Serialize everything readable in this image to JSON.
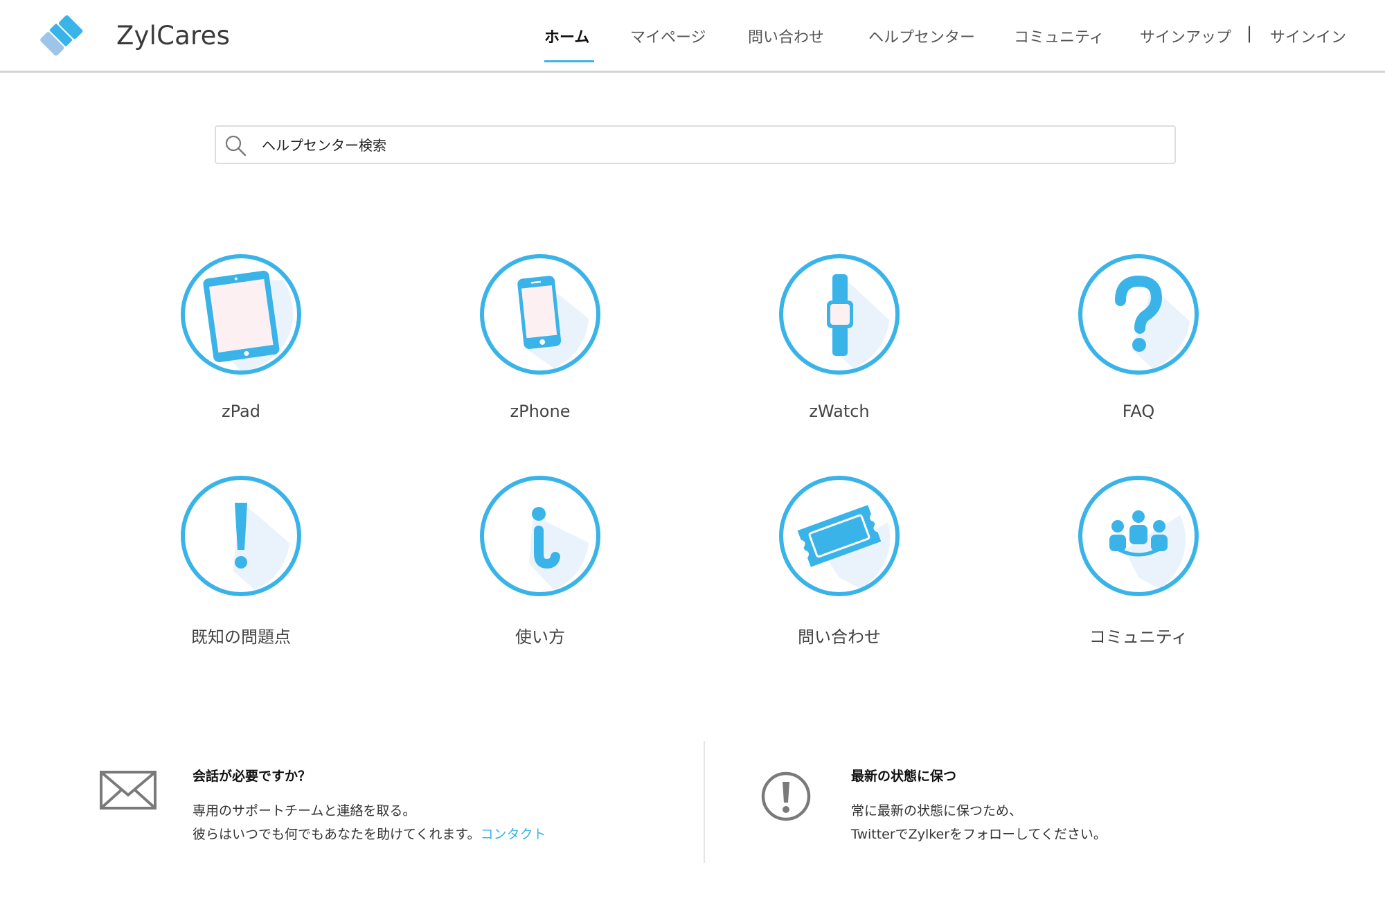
{
  "brand": {
    "name": "ZylCares",
    "colors": {
      "primary": "#39b3e8",
      "logo_light": "#9fc4ea"
    }
  },
  "nav": {
    "items": [
      {
        "label": "ホーム",
        "active": true
      },
      {
        "label": "マイページ"
      },
      {
        "label": "問い合わせ"
      },
      {
        "label": "ヘルプセンター"
      },
      {
        "label": "コミュニティ"
      },
      {
        "label": "サインアップ"
      },
      {
        "label": "サインイン"
      }
    ],
    "separator": "|"
  },
  "search": {
    "placeholder": "ヘルプセンター検索",
    "icon": "search-icon"
  },
  "tiles": [
    {
      "label": "zPad",
      "icon": "tablet-icon"
    },
    {
      "label": "zPhone",
      "icon": "phone-icon"
    },
    {
      "label": "zWatch",
      "icon": "watch-icon"
    },
    {
      "label": "FAQ",
      "icon": "question-icon"
    },
    {
      "label": "既知の問題点",
      "icon": "exclamation-icon"
    },
    {
      "label": "使い方",
      "icon": "info-icon"
    },
    {
      "label": "問い合わせ",
      "icon": "ticket-icon"
    },
    {
      "label": "コミュニティ",
      "icon": "community-icon"
    }
  ],
  "footer": {
    "contact": {
      "icon": "envelope-icon",
      "title": "会話が必要ですか？",
      "line1": "専用のサポートチームと連絡を取る。",
      "line2": "彼らはいつでも何でもあなたを助けてくれます。",
      "link": "コンタクト"
    },
    "updates": {
      "icon": "alert-icon",
      "title": "最新の状態に保つ",
      "line1": "常に最新の状態に保つため、",
      "line2": "TwitterでZylkerをフォローしてください。"
    }
  }
}
